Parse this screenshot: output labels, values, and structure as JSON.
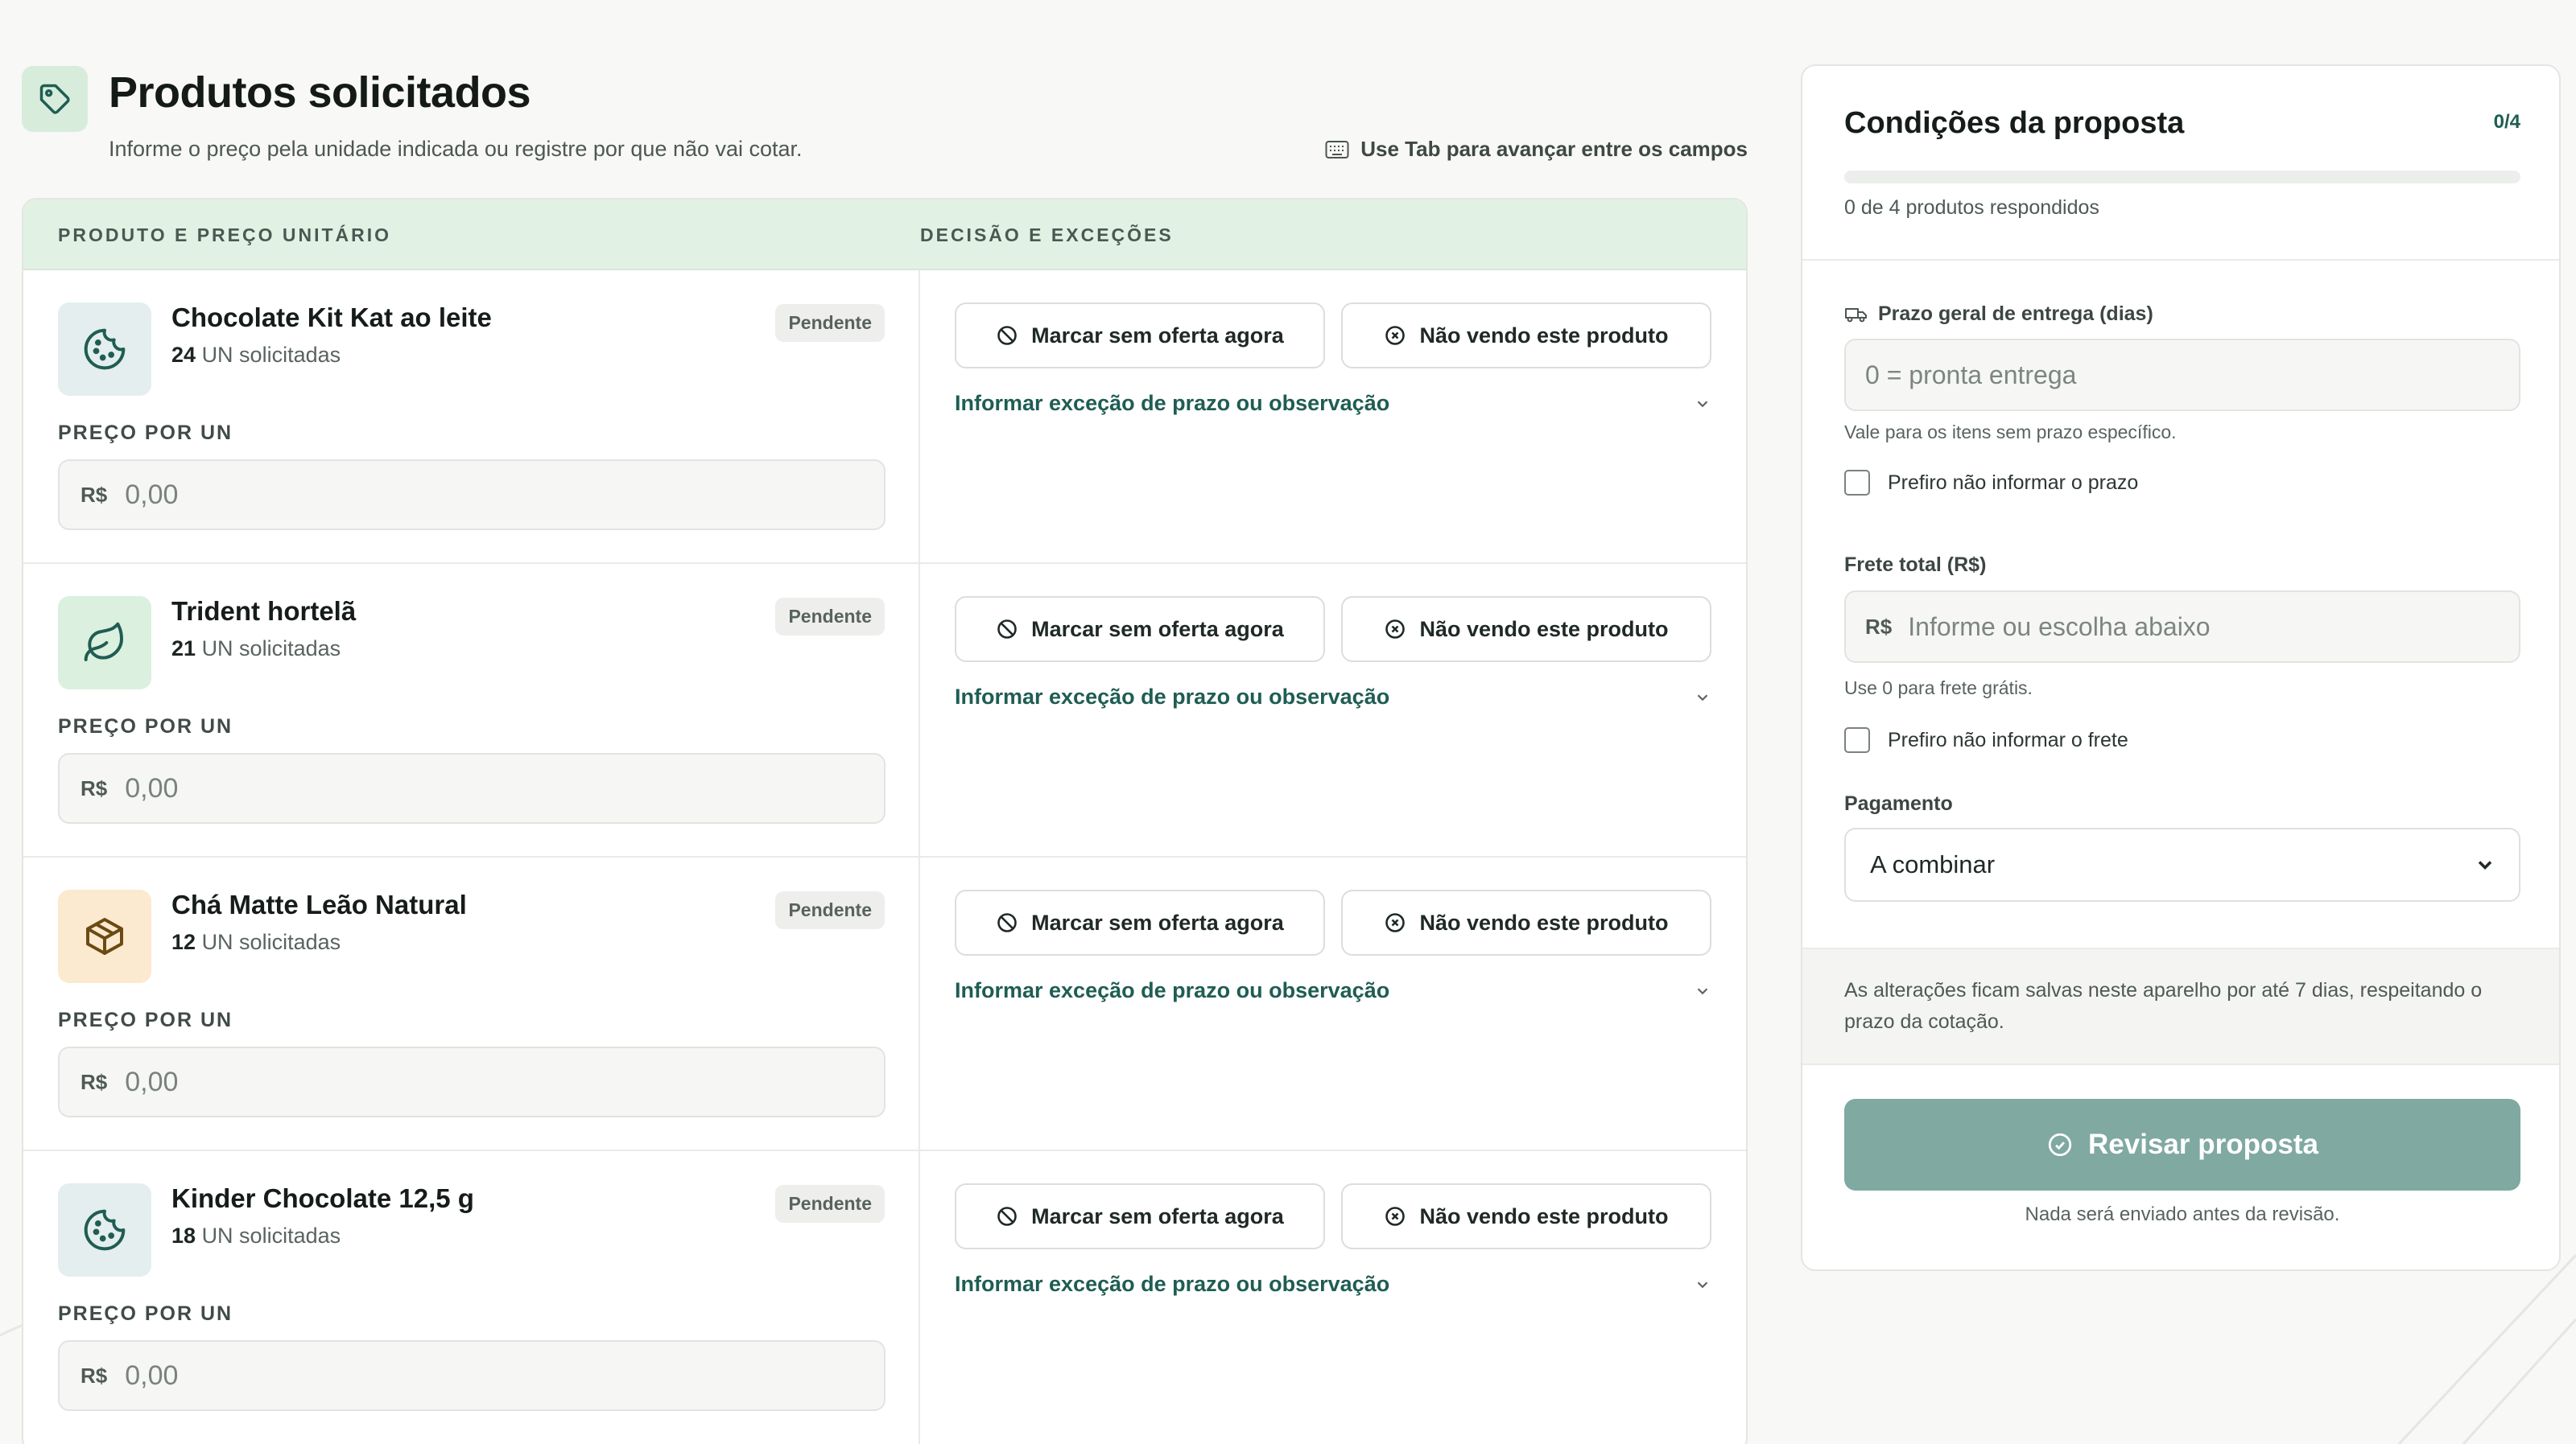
{
  "header": {
    "title": "Produtos solicitados",
    "subtitle": "Informe o preço pela unidade indicada ou registre por que não vai cotar.",
    "hint": "Use Tab para avançar entre os campos",
    "icon": "tag-icon"
  },
  "table": {
    "col_product": "PRODUTO E PREÇO UNITÁRIO",
    "col_decision": "DECISÃO E EXCEÇÕES"
  },
  "products": [
    {
      "name": "Chocolate Kit Kat ao leite",
      "qty": "24",
      "qty_unit": "UN solicitadas",
      "status": "Pendente",
      "price_label": "PREÇO POR UN",
      "currency": "R$",
      "placeholder": "0,00",
      "icon": "cookie-icon",
      "icon_bg": "#e4eeee"
    },
    {
      "name": "Trident hortelã",
      "qty": "21",
      "qty_unit": "UN solicitadas",
      "status": "Pendente",
      "price_label": "PREÇO POR UN",
      "currency": "R$",
      "placeholder": "0,00",
      "icon": "leaf-icon",
      "icon_bg": "#dcf0e0"
    },
    {
      "name": "Chá Matte Leão Natural",
      "qty": "12",
      "qty_unit": "UN solicitadas",
      "status": "Pendente",
      "price_label": "PREÇO POR UN",
      "currency": "R$",
      "placeholder": "0,00",
      "icon": "package-icon",
      "icon_bg": "#fbead0"
    },
    {
      "name": "Kinder Chocolate 12,5 g",
      "qty": "18",
      "qty_unit": "UN solicitadas",
      "status": "Pendente",
      "price_label": "PREÇO POR UN",
      "currency": "R$",
      "placeholder": "0,00",
      "icon": "cookie-icon",
      "icon_bg": "#e4eeee"
    }
  ],
  "actions": {
    "no_offer": "Marcar sem oferta agora",
    "not_sold": "Não vendo este produto",
    "exception": "Informar exceção de prazo ou observação"
  },
  "panel": {
    "title": "Condições da proposta",
    "count": "0/4",
    "progress": 0,
    "progress_text": "0 de 4 produtos respondidos",
    "delivery_label": "Prazo geral de entrega (dias)",
    "delivery_placeholder": "0 = pronta entrega",
    "delivery_help": "Vale para os itens sem prazo específico.",
    "delivery_check": "Prefiro não informar o prazo",
    "freight_label": "Frete total (R$)",
    "freight_currency": "R$",
    "freight_placeholder": "Informe ou escolha abaixo",
    "freight_help": "Use 0 para frete grátis.",
    "freight_check": "Prefiro não informar o frete",
    "payment_label": "Pagamento",
    "payment_value": "A combinar",
    "note": "As alterações ficam salvas neste aparelho por até 7 dias, respeitando o prazo da cotação.",
    "review_button": "Revisar proposta",
    "footer": "Nada será enviado antes da revisão."
  },
  "colors": {
    "accent": "#1f5d53",
    "header_bg": "#e1f2e4",
    "review_bg": "#7fa9a1"
  }
}
